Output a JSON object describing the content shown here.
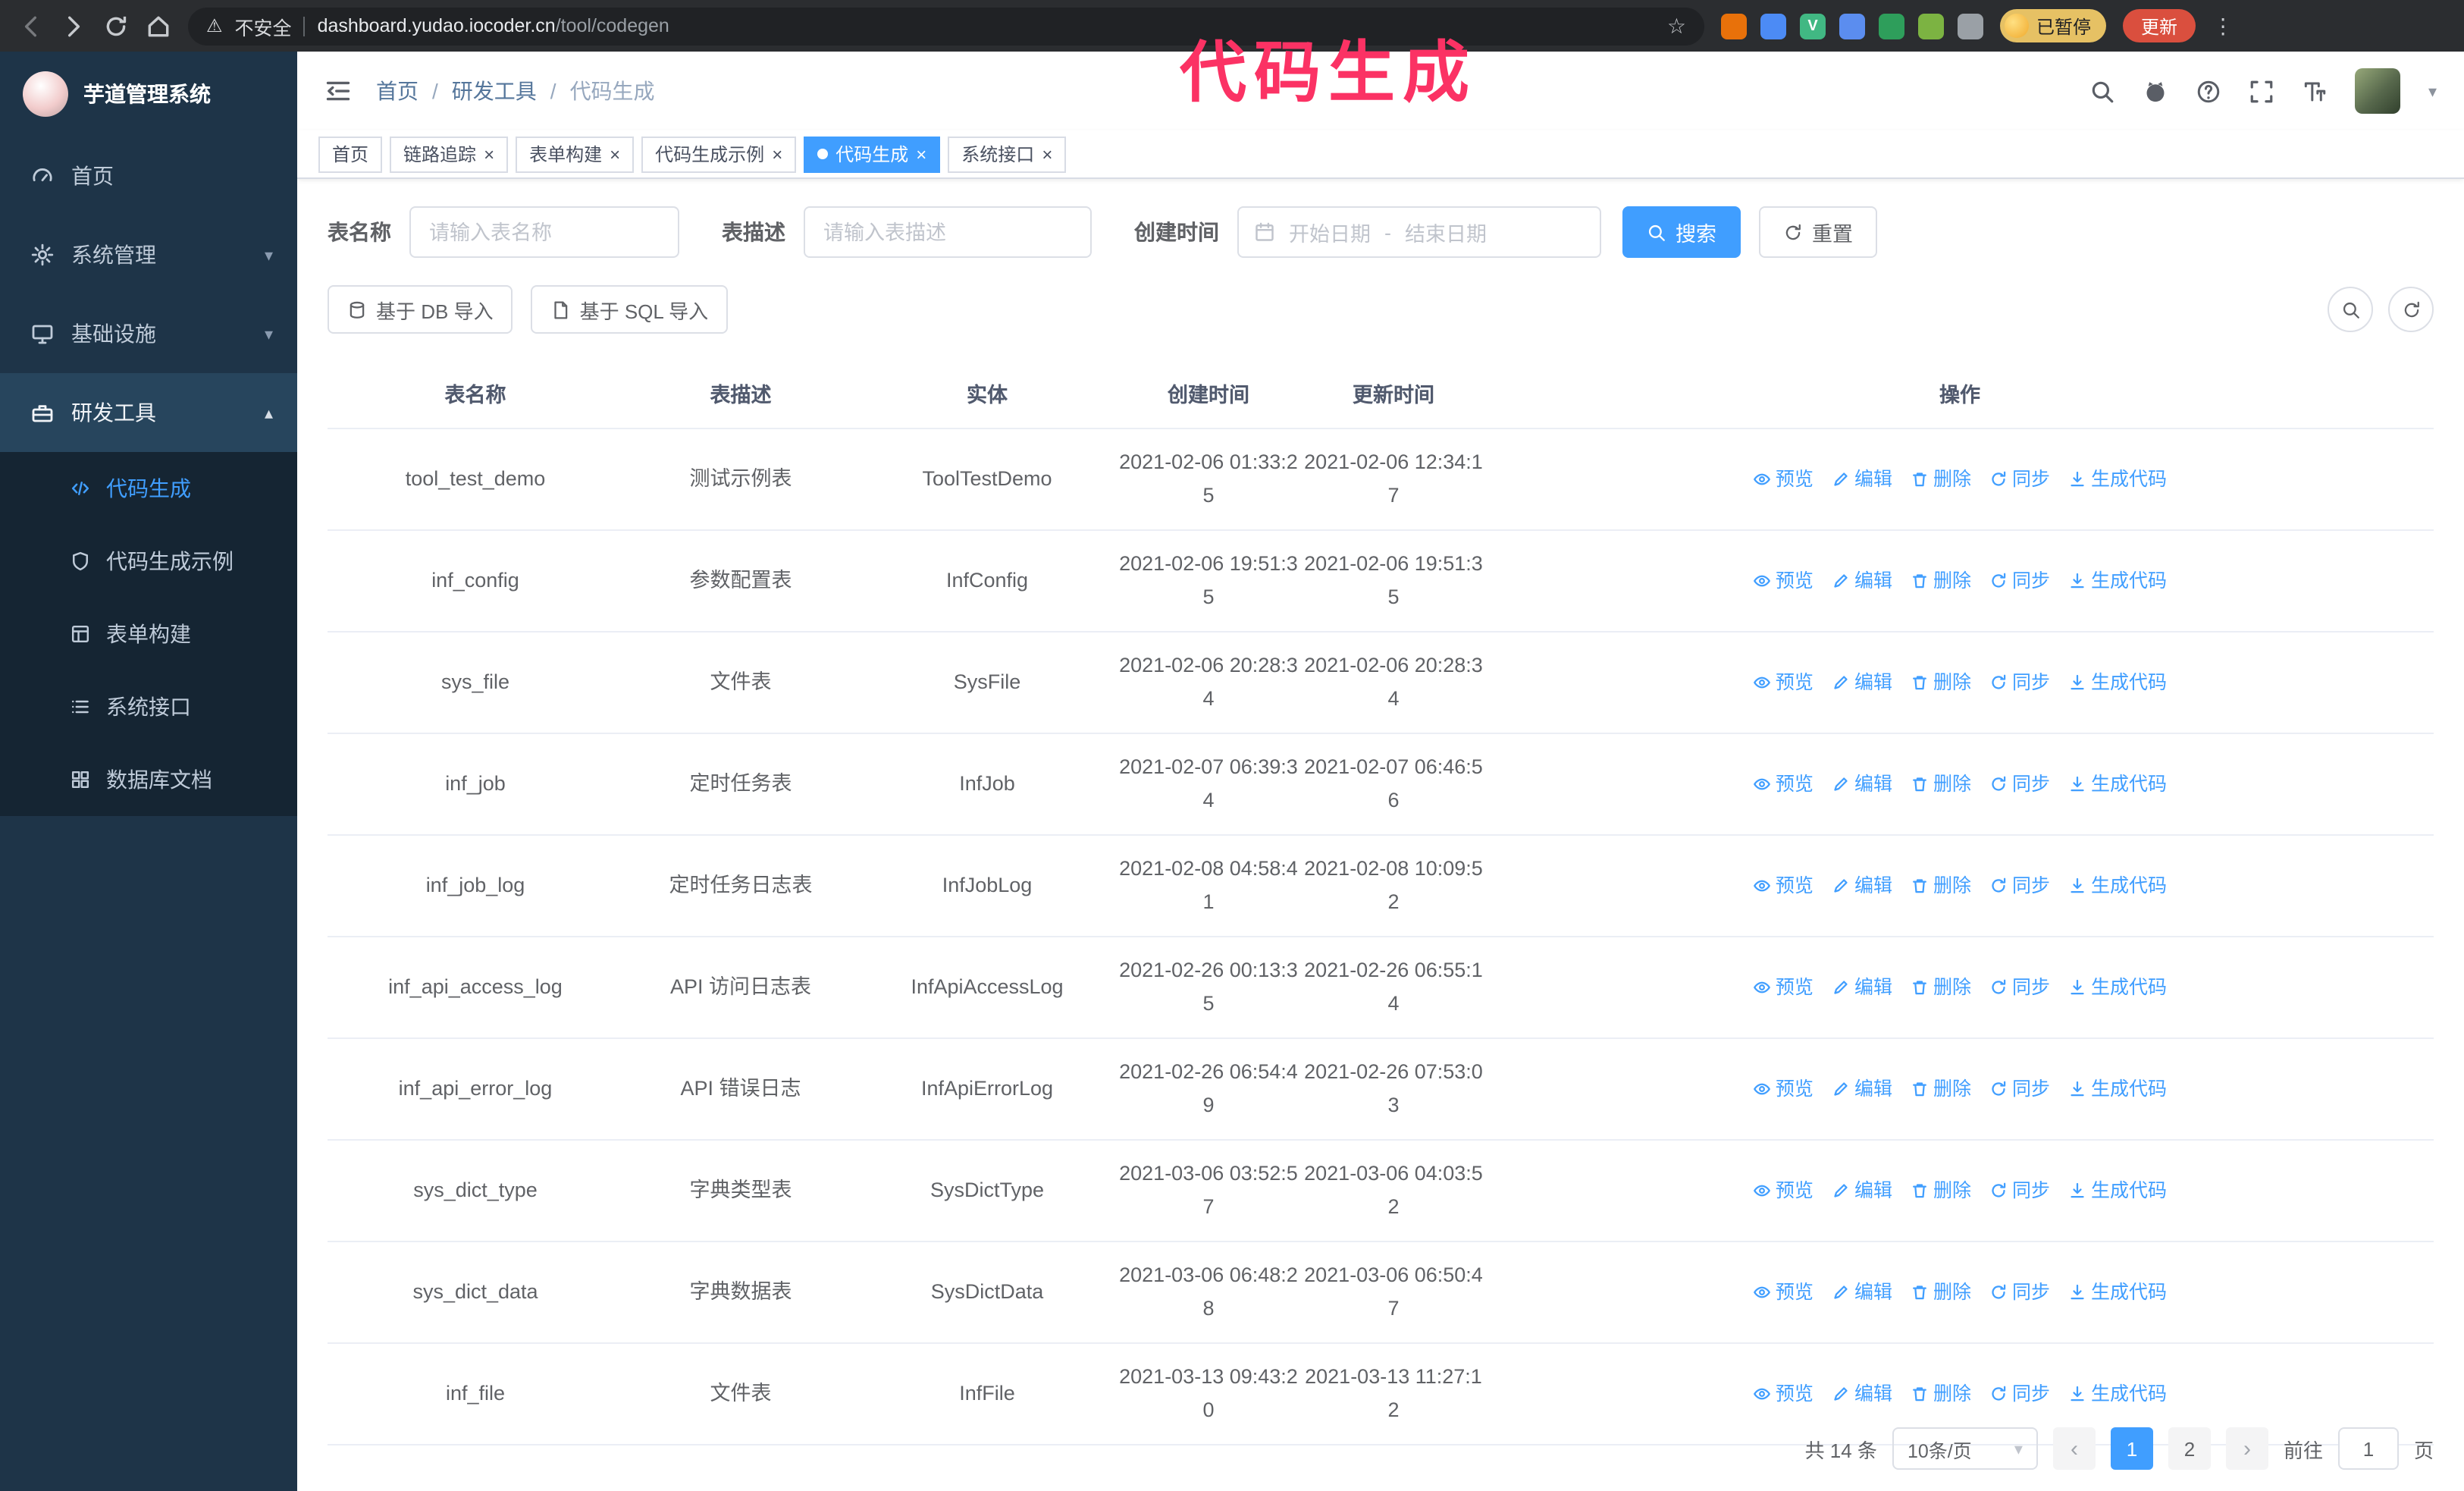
{
  "colors": {
    "accent": "#409eff",
    "annotation_pink": "#fb3264",
    "sidebar_bg": "#1e3448",
    "submenu_bg": "#152533",
    "update_button_red": "#da4f3e",
    "paused_chip_yellow": "#e6c164"
  },
  "icons": {
    "close": "×",
    "menu_dots": "⋮",
    "star": "☆",
    "warning": "⚠",
    "caret_down": "▾",
    "chevron_down": "▾",
    "chevron_up": "▴",
    "prev": "‹",
    "next": "›"
  },
  "browser": {
    "security_label": "不安全",
    "url_host": "dashboard.yudao.iocoder.cn",
    "url_path": "/tool/codegen",
    "paused_badge": "已暂停",
    "update_button": "更新",
    "extensions": [
      {
        "name": "extension-orange",
        "color": "#e8710a",
        "glyph": ""
      },
      {
        "name": "extension-blue",
        "color": "#4c8bf5",
        "glyph": ""
      },
      {
        "name": "extension-vue-devtools",
        "color": "#41b883",
        "glyph": "V"
      },
      {
        "name": "extension-people",
        "color": "#5b8def",
        "glyph": ""
      },
      {
        "name": "extension-card",
        "color": "#2e9e5b",
        "glyph": ""
      },
      {
        "name": "extension-leaf",
        "color": "#7cb342",
        "glyph": ""
      },
      {
        "name": "extension-puzzle",
        "color": "#9aa0a6",
        "glyph": ""
      }
    ]
  },
  "annotation": {
    "text": "代码生成"
  },
  "sidebar": {
    "logo_title": "芋道管理系统",
    "items": [
      {
        "label": "首页"
      },
      {
        "label": "系统管理"
      },
      {
        "label": "基础设施"
      },
      {
        "label": "研发工具"
      }
    ],
    "subitems": [
      {
        "label": "代码生成"
      },
      {
        "label": "代码生成示例"
      },
      {
        "label": "表单构建"
      },
      {
        "label": "系统接口"
      },
      {
        "label": "数据库文档"
      }
    ]
  },
  "header": {
    "breadcrumb": [
      "首页",
      "研发工具",
      "代码生成"
    ],
    "separator": "/"
  },
  "tabs": [
    {
      "label": "首页"
    },
    {
      "label": "链路追踪"
    },
    {
      "label": "表单构建"
    },
    {
      "label": "代码生成示例"
    },
    {
      "label": "代码生成"
    },
    {
      "label": "系统接口"
    }
  ],
  "filters": {
    "table_name_label": "表名称",
    "table_name_placeholder": "请输入表名称",
    "table_desc_label": "表描述",
    "table_desc_placeholder": "请输入表描述",
    "create_time_label": "创建时间",
    "start_date_placeholder": "开始日期",
    "range_separator": "-",
    "end_date_placeholder": "结束日期",
    "search_button": "搜索",
    "reset_button": "重置"
  },
  "toolbar": {
    "import_db_button": "基于 DB 导入",
    "import_sql_button": "基于 SQL 导入"
  },
  "table": {
    "columns": [
      "表名称",
      "表描述",
      "实体",
      "创建时间",
      "更新时间",
      "操作"
    ],
    "actions": [
      {
        "name": "preview",
        "label": "预览",
        "icon": "eye"
      },
      {
        "name": "edit",
        "label": "编辑",
        "icon": "edit"
      },
      {
        "name": "delete",
        "label": "删除",
        "icon": "delete"
      },
      {
        "name": "sync",
        "label": "同步",
        "icon": "sync"
      },
      {
        "name": "generate-code",
        "label": "生成代码",
        "icon": "download"
      }
    ],
    "rows": [
      {
        "name": "tool_test_demo",
        "desc": "测试示例表",
        "entity": "ToolTestDemo",
        "created": "2021-02-06 01:33:25",
        "updated": "2021-02-06 12:34:17"
      },
      {
        "name": "inf_config",
        "desc": "参数配置表",
        "entity": "InfConfig",
        "created": "2021-02-06 19:51:35",
        "updated": "2021-02-06 19:51:35"
      },
      {
        "name": "sys_file",
        "desc": "文件表",
        "entity": "SysFile",
        "created": "2021-02-06 20:28:34",
        "updated": "2021-02-06 20:28:34"
      },
      {
        "name": "inf_job",
        "desc": "定时任务表",
        "entity": "InfJob",
        "created": "2021-02-07 06:39:34",
        "updated": "2021-02-07 06:46:56"
      },
      {
        "name": "inf_job_log",
        "desc": "定时任务日志表",
        "entity": "InfJobLog",
        "created": "2021-02-08 04:58:41",
        "updated": "2021-02-08 10:09:52"
      },
      {
        "name": "inf_api_access_log",
        "desc": "API 访问日志表",
        "entity": "InfApiAccessLog",
        "created": "2021-02-26 00:13:35",
        "updated": "2021-02-26 06:55:14"
      },
      {
        "name": "inf_api_error_log",
        "desc": "API 错误日志",
        "entity": "InfApiErrorLog",
        "created": "2021-02-26 06:54:49",
        "updated": "2021-02-26 07:53:03"
      },
      {
        "name": "sys_dict_type",
        "desc": "字典类型表",
        "entity": "SysDictType",
        "created": "2021-03-06 03:52:57",
        "updated": "2021-03-06 04:03:52"
      },
      {
        "name": "sys_dict_data",
        "desc": "字典数据表",
        "entity": "SysDictData",
        "created": "2021-03-06 06:48:28",
        "updated": "2021-03-06 06:50:47"
      },
      {
        "name": "inf_file",
        "desc": "文件表",
        "entity": "InfFile",
        "created": "2021-03-13 09:43:20",
        "updated": "2021-03-13 11:27:12"
      }
    ]
  },
  "pagination": {
    "total_label": "共 14 条",
    "page_size_label": "10条/页",
    "pages": [
      "1",
      "2"
    ],
    "goto_label": "前往",
    "goto_value": "1",
    "goto_suffix": "页"
  }
}
